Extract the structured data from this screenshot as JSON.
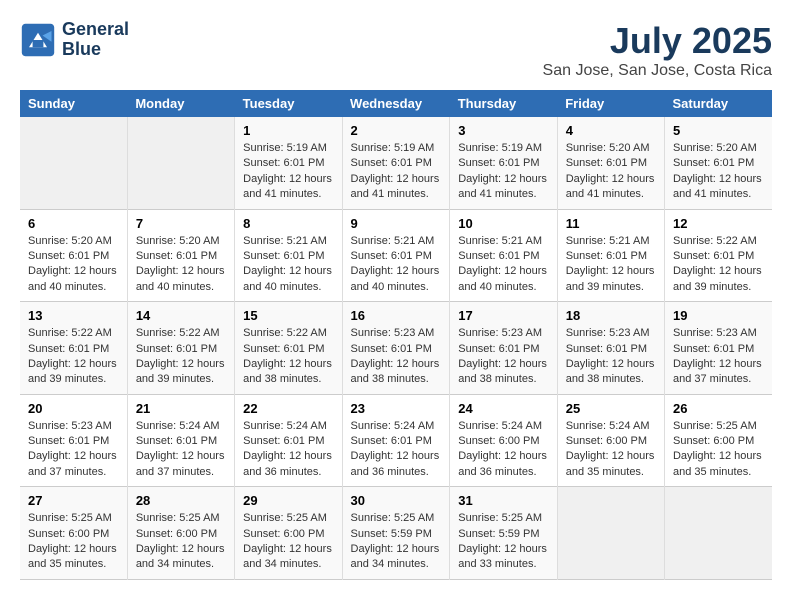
{
  "header": {
    "logo_line1": "General",
    "logo_line2": "Blue",
    "month": "July 2025",
    "location": "San Jose, San Jose, Costa Rica"
  },
  "days_of_week": [
    "Sunday",
    "Monday",
    "Tuesday",
    "Wednesday",
    "Thursday",
    "Friday",
    "Saturday"
  ],
  "weeks": [
    [
      {
        "num": "",
        "info": ""
      },
      {
        "num": "",
        "info": ""
      },
      {
        "num": "1",
        "info": "Sunrise: 5:19 AM\nSunset: 6:01 PM\nDaylight: 12 hours and 41 minutes."
      },
      {
        "num": "2",
        "info": "Sunrise: 5:19 AM\nSunset: 6:01 PM\nDaylight: 12 hours and 41 minutes."
      },
      {
        "num": "3",
        "info": "Sunrise: 5:19 AM\nSunset: 6:01 PM\nDaylight: 12 hours and 41 minutes."
      },
      {
        "num": "4",
        "info": "Sunrise: 5:20 AM\nSunset: 6:01 PM\nDaylight: 12 hours and 41 minutes."
      },
      {
        "num": "5",
        "info": "Sunrise: 5:20 AM\nSunset: 6:01 PM\nDaylight: 12 hours and 41 minutes."
      }
    ],
    [
      {
        "num": "6",
        "info": "Sunrise: 5:20 AM\nSunset: 6:01 PM\nDaylight: 12 hours and 40 minutes."
      },
      {
        "num": "7",
        "info": "Sunrise: 5:20 AM\nSunset: 6:01 PM\nDaylight: 12 hours and 40 minutes."
      },
      {
        "num": "8",
        "info": "Sunrise: 5:21 AM\nSunset: 6:01 PM\nDaylight: 12 hours and 40 minutes."
      },
      {
        "num": "9",
        "info": "Sunrise: 5:21 AM\nSunset: 6:01 PM\nDaylight: 12 hours and 40 minutes."
      },
      {
        "num": "10",
        "info": "Sunrise: 5:21 AM\nSunset: 6:01 PM\nDaylight: 12 hours and 40 minutes."
      },
      {
        "num": "11",
        "info": "Sunrise: 5:21 AM\nSunset: 6:01 PM\nDaylight: 12 hours and 39 minutes."
      },
      {
        "num": "12",
        "info": "Sunrise: 5:22 AM\nSunset: 6:01 PM\nDaylight: 12 hours and 39 minutes."
      }
    ],
    [
      {
        "num": "13",
        "info": "Sunrise: 5:22 AM\nSunset: 6:01 PM\nDaylight: 12 hours and 39 minutes."
      },
      {
        "num": "14",
        "info": "Sunrise: 5:22 AM\nSunset: 6:01 PM\nDaylight: 12 hours and 39 minutes."
      },
      {
        "num": "15",
        "info": "Sunrise: 5:22 AM\nSunset: 6:01 PM\nDaylight: 12 hours and 38 minutes."
      },
      {
        "num": "16",
        "info": "Sunrise: 5:23 AM\nSunset: 6:01 PM\nDaylight: 12 hours and 38 minutes."
      },
      {
        "num": "17",
        "info": "Sunrise: 5:23 AM\nSunset: 6:01 PM\nDaylight: 12 hours and 38 minutes."
      },
      {
        "num": "18",
        "info": "Sunrise: 5:23 AM\nSunset: 6:01 PM\nDaylight: 12 hours and 38 minutes."
      },
      {
        "num": "19",
        "info": "Sunrise: 5:23 AM\nSunset: 6:01 PM\nDaylight: 12 hours and 37 minutes."
      }
    ],
    [
      {
        "num": "20",
        "info": "Sunrise: 5:23 AM\nSunset: 6:01 PM\nDaylight: 12 hours and 37 minutes."
      },
      {
        "num": "21",
        "info": "Sunrise: 5:24 AM\nSunset: 6:01 PM\nDaylight: 12 hours and 37 minutes."
      },
      {
        "num": "22",
        "info": "Sunrise: 5:24 AM\nSunset: 6:01 PM\nDaylight: 12 hours and 36 minutes."
      },
      {
        "num": "23",
        "info": "Sunrise: 5:24 AM\nSunset: 6:01 PM\nDaylight: 12 hours and 36 minutes."
      },
      {
        "num": "24",
        "info": "Sunrise: 5:24 AM\nSunset: 6:00 PM\nDaylight: 12 hours and 36 minutes."
      },
      {
        "num": "25",
        "info": "Sunrise: 5:24 AM\nSunset: 6:00 PM\nDaylight: 12 hours and 35 minutes."
      },
      {
        "num": "26",
        "info": "Sunrise: 5:25 AM\nSunset: 6:00 PM\nDaylight: 12 hours and 35 minutes."
      }
    ],
    [
      {
        "num": "27",
        "info": "Sunrise: 5:25 AM\nSunset: 6:00 PM\nDaylight: 12 hours and 35 minutes."
      },
      {
        "num": "28",
        "info": "Sunrise: 5:25 AM\nSunset: 6:00 PM\nDaylight: 12 hours and 34 minutes."
      },
      {
        "num": "29",
        "info": "Sunrise: 5:25 AM\nSunset: 6:00 PM\nDaylight: 12 hours and 34 minutes."
      },
      {
        "num": "30",
        "info": "Sunrise: 5:25 AM\nSunset: 5:59 PM\nDaylight: 12 hours and 34 minutes."
      },
      {
        "num": "31",
        "info": "Sunrise: 5:25 AM\nSunset: 5:59 PM\nDaylight: 12 hours and 33 minutes."
      },
      {
        "num": "",
        "info": ""
      },
      {
        "num": "",
        "info": ""
      }
    ]
  ]
}
